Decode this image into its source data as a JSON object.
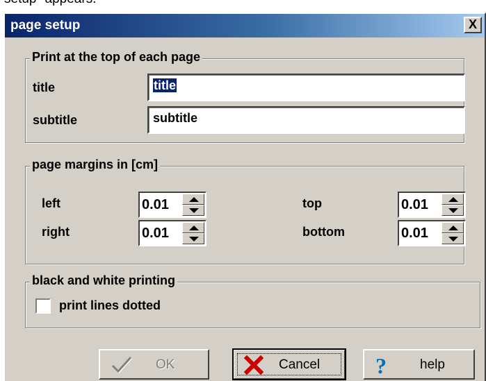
{
  "caption_fragment": "setup\" appears.",
  "window": {
    "title": "page setup",
    "close_label": "X"
  },
  "header_group": {
    "legend": "Print at the top of each page",
    "title_label": "title",
    "title_value": "title",
    "subtitle_label": "subtitle",
    "subtitle_value": "subtitle"
  },
  "margins_group": {
    "legend": "page margins in [cm]",
    "left_label": "left",
    "left_value": "0.01",
    "right_label": "right",
    "right_value": "0.01",
    "top_label": "top",
    "top_value": "0.01",
    "bottom_label": "bottom",
    "bottom_value": "0.01"
  },
  "bw_group": {
    "legend": "black and white printing",
    "dotted_label": "print lines dotted",
    "dotted_checked": false
  },
  "buttons": {
    "ok_label": "OK",
    "cancel_label": "Cancel",
    "help_label": "help"
  },
  "icons": {
    "ok": "checkmark-icon",
    "cancel": "red-x-icon",
    "help": "question-mark-icon",
    "colors": {
      "cancel_x": "#cc0000",
      "help_q": "#0070c0"
    }
  }
}
